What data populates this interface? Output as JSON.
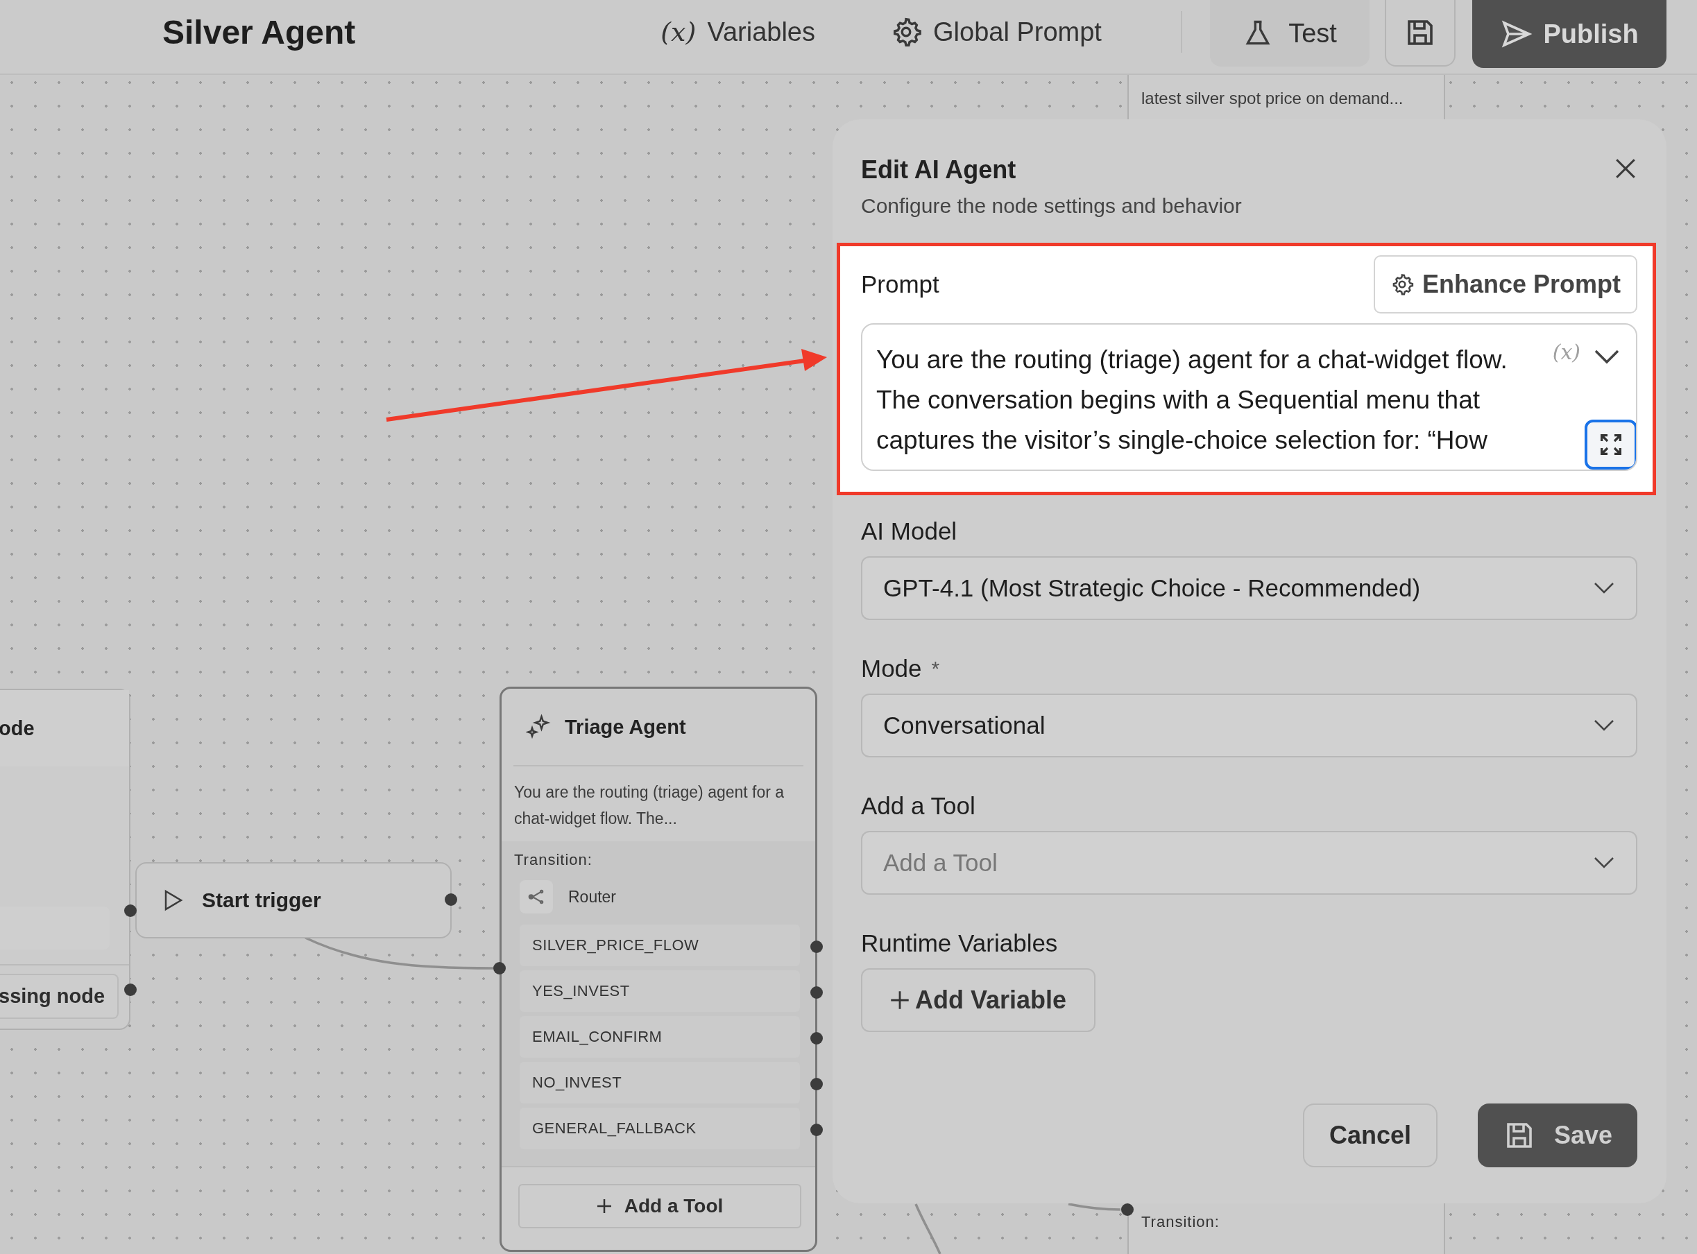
{
  "header": {
    "title": "Silver Agent",
    "actions": [
      {
        "kind": "variables",
        "icon": "(x)",
        "label": "Variables"
      },
      {
        "kind": "settings",
        "label": "Global Prompt"
      }
    ],
    "test_button": "Test",
    "publish_button": "Publish"
  },
  "canvas": {
    "top_node": {
      "text": "latest silver spot price on demand..."
    },
    "left_node": {
      "title": "ode",
      "item": "ssing node"
    },
    "start_node": {
      "label": "Start trigger"
    },
    "agent_node": {
      "title": "Triage Agent",
      "description": "You are the routing (triage) agent for a chat-widget flow. The...",
      "transition_label": "Transition:",
      "router": "Router",
      "transitions": [
        "SILVER_PRICE_FLOW",
        "YES_INVEST",
        "EMAIL_CONFIRM",
        "NO_INVEST",
        "GENERAL_FALLBACK"
      ],
      "add_tool": "Add a Tool"
    },
    "bottom_node": {
      "transition_label": "Transition:"
    }
  },
  "panel": {
    "title": "Edit AI Agent",
    "subtitle": "Configure the node settings and behavior",
    "prompt": {
      "label": "Prompt",
      "enhance_button": "Enhance Prompt",
      "variable_icon": "(x)",
      "lines": [
        "You are the routing (triage) agent for a chat-widget flow.",
        "The conversation begins with a Sequential menu that",
        "captures the visitor’s single-choice selection for: “How"
      ]
    },
    "fields": [
      {
        "kind": "select",
        "label": "AI Model",
        "value": "GPT-4.1 (Most Strategic Choice - Recommended)"
      },
      {
        "kind": "select",
        "label": "Mode",
        "required_mark": "*",
        "value": "Conversational"
      },
      {
        "kind": "select",
        "label": "Add a Tool",
        "placeholder": "Add a Tool"
      },
      {
        "kind": "button",
        "label": "Runtime Variables",
        "button": "Add Variable"
      }
    ],
    "cancel_button": "Cancel",
    "save_button": "Save"
  }
}
